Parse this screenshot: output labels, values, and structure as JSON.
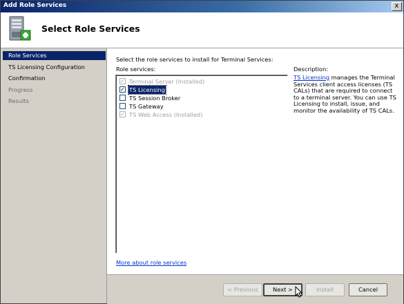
{
  "window": {
    "title": "Add Role Services",
    "close_glyph": "x"
  },
  "header": {
    "title": "Select Role Services",
    "icon": "server-add-icon"
  },
  "sidebar": {
    "items": [
      {
        "label": "Role Services",
        "state": "active"
      },
      {
        "label": "TS Licensing Configuration",
        "state": "enabled"
      },
      {
        "label": "Confirmation",
        "state": "enabled"
      },
      {
        "label": "Progress",
        "state": "disabled"
      },
      {
        "label": "Results",
        "state": "disabled"
      }
    ]
  },
  "main": {
    "instruction": "Select the role services to install for Terminal Services:",
    "role_services_label": "Role services:",
    "role_services": [
      {
        "label": "Terminal Server  (Installed)",
        "checked": true,
        "disabled": true,
        "selected": false
      },
      {
        "label": "TS Licensing",
        "checked": true,
        "disabled": false,
        "selected": true
      },
      {
        "label": "TS Session Broker",
        "checked": false,
        "disabled": false,
        "selected": false
      },
      {
        "label": "TS Gateway",
        "checked": false,
        "disabled": false,
        "selected": false
      },
      {
        "label": "TS Web Access  (Installed)",
        "checked": true,
        "disabled": true,
        "selected": false
      }
    ],
    "description_title": "Description:",
    "description_link": "TS Licensing",
    "description_text": " manages the Terminal Services client access licenses (TS CALs) that are required to connect to a terminal server. You can use TS Licensing to install, issue, and monitor the availability of TS CALs.",
    "more_link": "More about role services"
  },
  "buttons": {
    "previous": "< Previous",
    "next": "Next >",
    "install": "Install",
    "cancel": "Cancel"
  },
  "colors": {
    "title_bar": "#0a246a",
    "selection": "#0a246a",
    "link": "#0033cc",
    "panel": "#d4d0c8"
  }
}
